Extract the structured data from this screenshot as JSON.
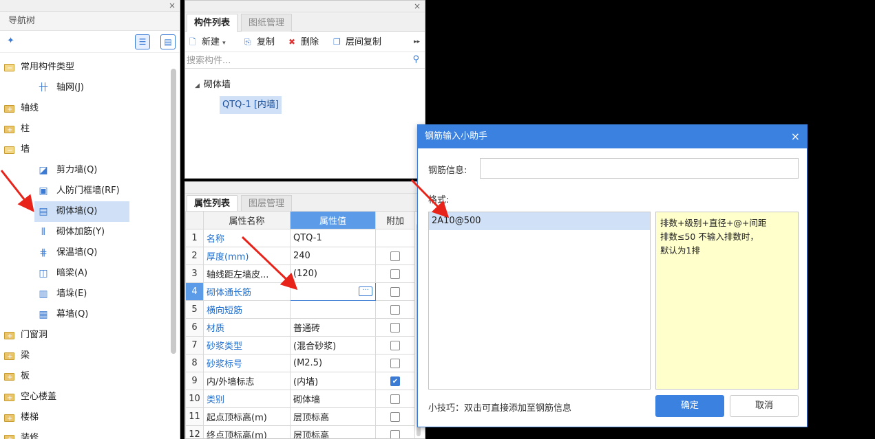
{
  "nav": {
    "title": "导航树",
    "close": "×",
    "tree": [
      {
        "label": "常用构件类型",
        "kind": "folder-open"
      },
      {
        "label": "轴网(J)",
        "kind": "item",
        "icon": "grid-icon",
        "glyph": "卄"
      },
      {
        "label": "轴线",
        "kind": "folder"
      },
      {
        "label": "柱",
        "kind": "folder"
      },
      {
        "label": "墙",
        "kind": "folder-open"
      },
      {
        "label": "剪力墙(Q)",
        "kind": "item",
        "icon": "shear-wall-icon",
        "glyph": "◪"
      },
      {
        "label": "人防门框墙(RF)",
        "kind": "item",
        "icon": "door-frame-wall-icon",
        "glyph": "▣"
      },
      {
        "label": "砌体墙(Q)",
        "kind": "item",
        "icon": "masonry-wall-icon",
        "glyph": "▤",
        "selected": true
      },
      {
        "label": "砌体加筋(Y)",
        "kind": "item",
        "icon": "masonry-rebar-icon",
        "glyph": "⫴"
      },
      {
        "label": "保温墙(Q)",
        "kind": "item",
        "icon": "insulation-wall-icon",
        "glyph": "⋕"
      },
      {
        "label": "暗梁(A)",
        "kind": "item",
        "icon": "hidden-beam-icon",
        "glyph": "◫"
      },
      {
        "label": "墙垛(E)",
        "kind": "item",
        "icon": "wall-pier-icon",
        "glyph": "▥"
      },
      {
        "label": "幕墙(Q)",
        "kind": "item",
        "icon": "curtain-wall-icon",
        "glyph": "▦"
      },
      {
        "label": "门窗洞",
        "kind": "folder"
      },
      {
        "label": "梁",
        "kind": "folder"
      },
      {
        "label": "板",
        "kind": "folder"
      },
      {
        "label": "空心楼盖",
        "kind": "folder"
      },
      {
        "label": "楼梯",
        "kind": "folder"
      },
      {
        "label": "装修",
        "kind": "folder"
      }
    ]
  },
  "components": {
    "close": "×",
    "tabs": [
      "构件列表",
      "图纸管理"
    ],
    "toolbar": {
      "new": "新建",
      "copy": "复制",
      "delete": "删除",
      "floor_copy": "层间复制",
      "more": "▸▸"
    },
    "search_placeholder": "搜索构件...",
    "group": "砌体墙",
    "item": "QTQ-1 [内墙]"
  },
  "properties": {
    "tabs": [
      "属性列表",
      "图层管理"
    ],
    "headers": [
      "属性名称",
      "属性值",
      "附加"
    ],
    "rows": [
      {
        "idx": "1",
        "name": "名称",
        "value": "QTQ-1",
        "blue": true,
        "has_check": false,
        "checked": false
      },
      {
        "idx": "2",
        "name": "厚度(mm)",
        "value": "240",
        "blue": true,
        "has_check": true,
        "checked": false
      },
      {
        "idx": "3",
        "name": "轴线距左墙皮...",
        "value": "(120)",
        "blue": false,
        "has_check": true,
        "checked": false
      },
      {
        "idx": "4",
        "name": "砌体通长筋",
        "value": "",
        "blue": true,
        "has_check": true,
        "checked": false,
        "editing": true
      },
      {
        "idx": "5",
        "name": "横向短筋",
        "value": "",
        "blue": true,
        "has_check": true,
        "checked": false
      },
      {
        "idx": "6",
        "name": "材质",
        "value": "普通砖",
        "blue": true,
        "has_check": true,
        "checked": false
      },
      {
        "idx": "7",
        "name": "砂浆类型",
        "value": "(混合砂浆)",
        "blue": true,
        "has_check": true,
        "checked": false
      },
      {
        "idx": "8",
        "name": "砂浆标号",
        "value": "(M2.5)",
        "blue": true,
        "has_check": true,
        "checked": false
      },
      {
        "idx": "9",
        "name": "内/外墙标志",
        "value": "(内墙)",
        "blue": false,
        "has_check": true,
        "checked": true
      },
      {
        "idx": "10",
        "name": "类别",
        "value": "砌体墙",
        "blue": true,
        "has_check": true,
        "checked": false
      },
      {
        "idx": "11",
        "name": "起点顶标高(m)",
        "value": "层顶标高",
        "blue": false,
        "has_check": true,
        "checked": false
      },
      {
        "idx": "12",
        "name": "终点顶标高(m)",
        "value": "层顶标高",
        "blue": false,
        "has_check": true,
        "checked": false
      }
    ]
  },
  "dialog": {
    "title": "钢筋输入小助手",
    "close": "×",
    "rebar_info_label": "钢筋信息:",
    "rebar_info_value": "",
    "format_label": "格式:",
    "format_items": [
      "2A10@500"
    ],
    "hint": "排数+级别+直径+@+间距\n排数≤50    不输入排数时，\n默认为1排",
    "tip": "小技巧：双击可直接添加至钢筋信息",
    "ok": "确定",
    "cancel": "取消"
  },
  "colors": {
    "accent": "#3b82e0",
    "selection": "#cfe0f7",
    "hint_bg": "#ffffcc",
    "arrow": "#e8231a"
  }
}
